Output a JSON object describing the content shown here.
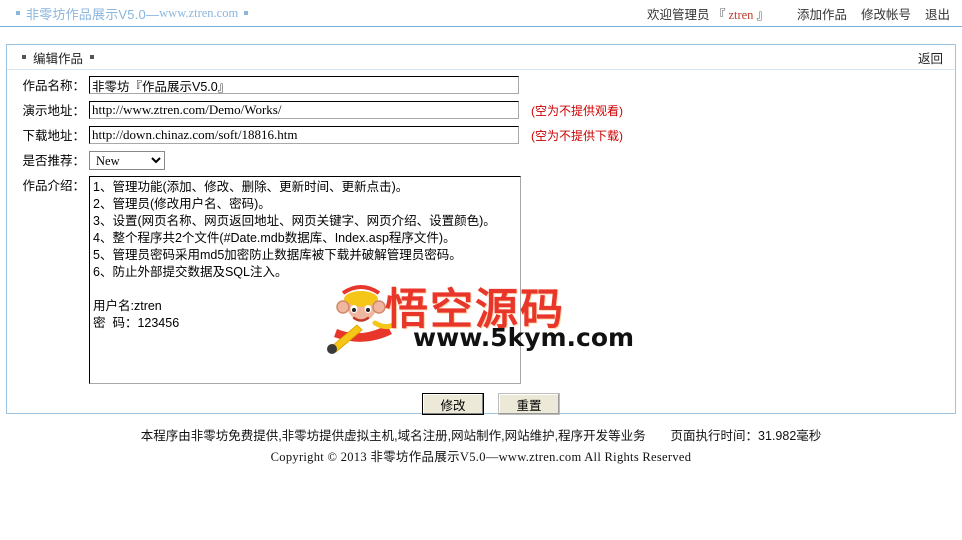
{
  "header": {
    "site_title_cn": "非零坊作品展示V5.0—",
    "site_title_en": "www.ztren.com",
    "welcome_prefix": "欢迎管理员 『",
    "welcome_user": "ztren",
    "welcome_suffix": "』",
    "nav": [
      {
        "label": "添加作品",
        "name": "add-work-link"
      },
      {
        "label": "修改帐号",
        "name": "edit-account-link"
      },
      {
        "label": "退出",
        "name": "logout-link"
      }
    ]
  },
  "panel": {
    "heading": "编辑作品",
    "back_label": "返回"
  },
  "form": {
    "name_label": "作品名称：",
    "name_value": "非零坊『作品展示V5.0』",
    "demo_label": "演示地址：",
    "demo_value": "http://www.ztren.com/Demo/Works/",
    "demo_hint": "(空为不提供观看)",
    "download_label": "下载地址：",
    "download_value": "http://down.chinaz.com/soft/18816.htm",
    "download_hint": "(空为不提供下载)",
    "recommend_label": "是否推荐：",
    "recommend_value": "New",
    "recommend_options": [
      "New"
    ],
    "intro_label": "作品介绍：",
    "intro_value": "1、管理功能(添加、修改、删除、更新时间、更新点击)。\n2、管理员(修改用户名、密码)。\n3、设置(网页名称、网页返回地址、网页关键字、网页介绍、设置颜色)。\n4、整个程序共2个文件(#Date.mdb数据库、Index.asp程序文件)。\n5、管理员密码采用md5加密防止数据库被下载并破解管理员密码。\n6、防止外部提交数据及SQL注入。\n\n用户名:ztren\n密  码：123456",
    "submit_label": "修改",
    "reset_label": "重置"
  },
  "footer": {
    "line1": "本程序由非零坊免费提供,非零坊提供虚拟主机,域名注册,网站制作,网站维护,程序开发等业务",
    "exec_time": "页面执行时间：31.982毫秒",
    "line2": "Copyright © 2013 非零坊作品展示V5.0—www.ztren.com All Rights Reserved"
  },
  "watermark": {
    "text": "悟空源码",
    "url": "www.5kym.com"
  },
  "colors": {
    "accent_blue": "#8ab6dd",
    "border_blue": "#9cc3e0",
    "hint_red": "#cc0000",
    "user_red": "#c0392b",
    "watermark_red": "#e8372a"
  }
}
